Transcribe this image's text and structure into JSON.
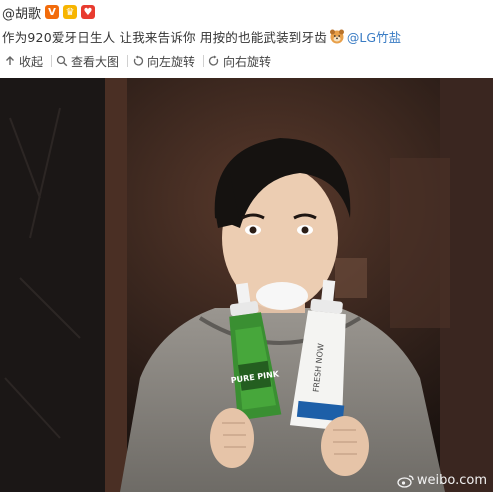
{
  "post": {
    "author": "@胡歌",
    "text": "作为920爱牙日生人 让我来告诉你 用按的也能武装到牙齿",
    "mention": "@LG竹盐"
  },
  "toolbar": {
    "collapse_label": "收起",
    "view_large_label": "查看大图",
    "rotate_left_label": "向左旋转",
    "rotate_right_label": "向右旋转"
  },
  "photo": {
    "watermark": "weibo.com",
    "bottle_left_label": "PURE PINK",
    "bottle_right_label": "FRESH NOW"
  },
  "colors": {
    "mention": "#3a7cc4",
    "vip_badge": "#f26b0b",
    "crown_badge": "#f7b500",
    "heart_badge": "#e83b2f"
  }
}
